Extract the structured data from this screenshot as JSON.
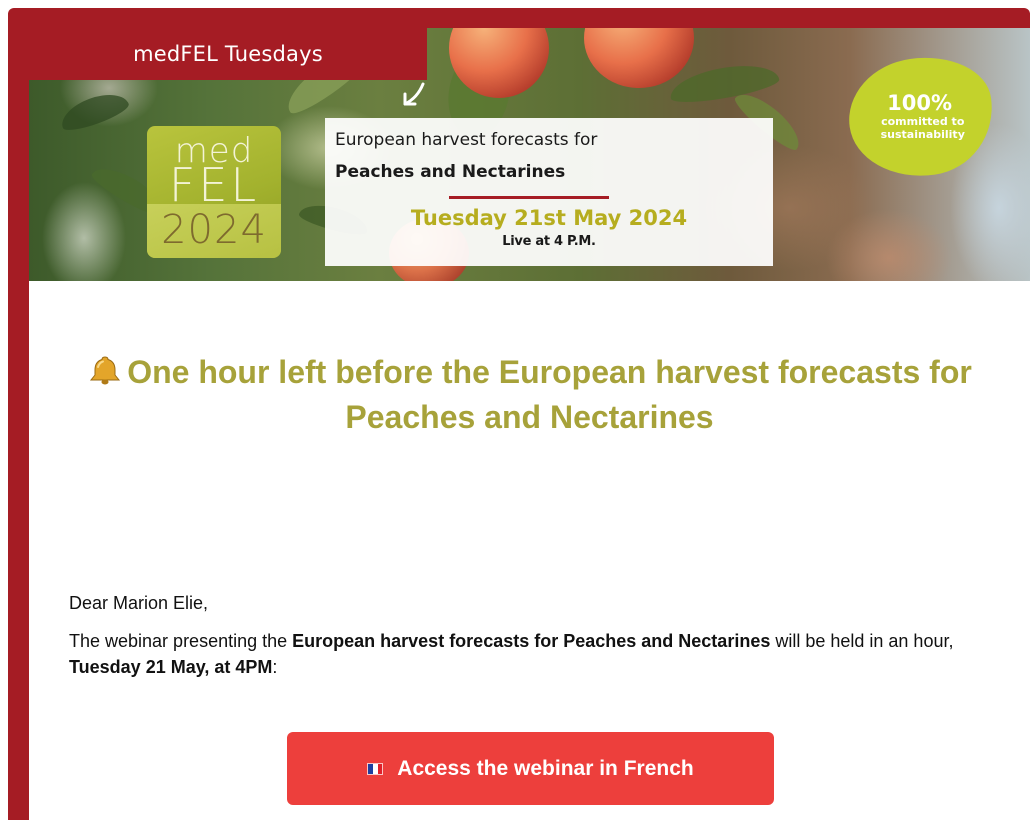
{
  "hero": {
    "tab_label": "medFEL Tuesdays",
    "logo": {
      "line1": "med",
      "line2": "FEL",
      "year": "2024"
    },
    "info": {
      "line1": "European harvest forecasts for",
      "line2": "Peaches and Nectarines",
      "date": "Tuesday 21st May 2024",
      "time": "Live at 4 P.M."
    },
    "badge": {
      "percent": "100%",
      "text_line1": "committed to",
      "text_line2": "sustainability"
    }
  },
  "email": {
    "headline_icon": "bell-icon",
    "headline": "One hour left before the European harvest forecasts for Peaches and Nectarines",
    "greeting": "Dear Marion Elie,",
    "paragraph": {
      "part1": "The webinar presenting the ",
      "bold1": "European harvest forecasts for Peaches and Nectarines",
      "part2": " will be held in an hour, ",
      "bold2": "Tuesday 21 May, at 4PM",
      "part3": ":"
    },
    "cta": {
      "icon": "french-flag-icon",
      "label": "Access the webinar in French",
      "color": "#ed3f3c"
    }
  },
  "colors": {
    "frame": "#a51c24",
    "headline": "#a7a23a",
    "badge": "#c3d22c",
    "date": "#b6ad1f"
  }
}
